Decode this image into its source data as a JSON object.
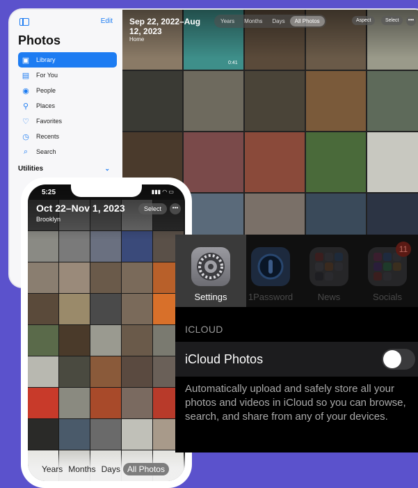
{
  "ipad": {
    "sidebar": {
      "edit_label": "Edit",
      "title": "Photos",
      "items": [
        {
          "label": "Library",
          "icon": "photo-library-icon"
        },
        {
          "label": "For You",
          "icon": "for-you-icon"
        },
        {
          "label": "People",
          "icon": "person-icon"
        },
        {
          "label": "Places",
          "icon": "map-pin-icon"
        },
        {
          "label": "Favorites",
          "icon": "heart-icon"
        },
        {
          "label": "Recents",
          "icon": "clock-icon"
        },
        {
          "label": "Search",
          "icon": "search-icon"
        }
      ],
      "section_utilities": "Utilities"
    },
    "grid": {
      "date_range": "Sep 22, 2022–Aug 12, 2023",
      "place": "Home",
      "tabs": [
        "Years",
        "Months",
        "Days",
        "All Photos"
      ],
      "active_tab": "All Photos",
      "aspect_label": "Aspect",
      "select_label": "Select",
      "video_duration": "0:41"
    }
  },
  "iphone": {
    "time": "5:25",
    "status_icons": "▮▮▮ ◠ ▭",
    "date_range": "Oct 22–Nov 1, 2023",
    "place": "Brooklyn",
    "select_label": "Select",
    "tabs": [
      "Years",
      "Months",
      "Days",
      "All Photos"
    ],
    "active_tab": "All Photos"
  },
  "settings": {
    "apps": [
      {
        "label": "Settings",
        "icon": "gear-icon"
      },
      {
        "label": "1Password",
        "icon": "onepassword-icon"
      },
      {
        "label": "News",
        "icon": "folder-icon"
      },
      {
        "label": "Socials",
        "icon": "folder-icon",
        "badge": "11"
      }
    ],
    "section_title": "ICLOUD",
    "toggle_label": "iCloud Photos",
    "toggle_on": false,
    "description": "Automatically upload and safely store all your photos and videos in iCloud so you can browse, search, and share from any of your devices."
  },
  "colors": {
    "background": "#5b52cc",
    "accent": "#1d7cf2"
  }
}
